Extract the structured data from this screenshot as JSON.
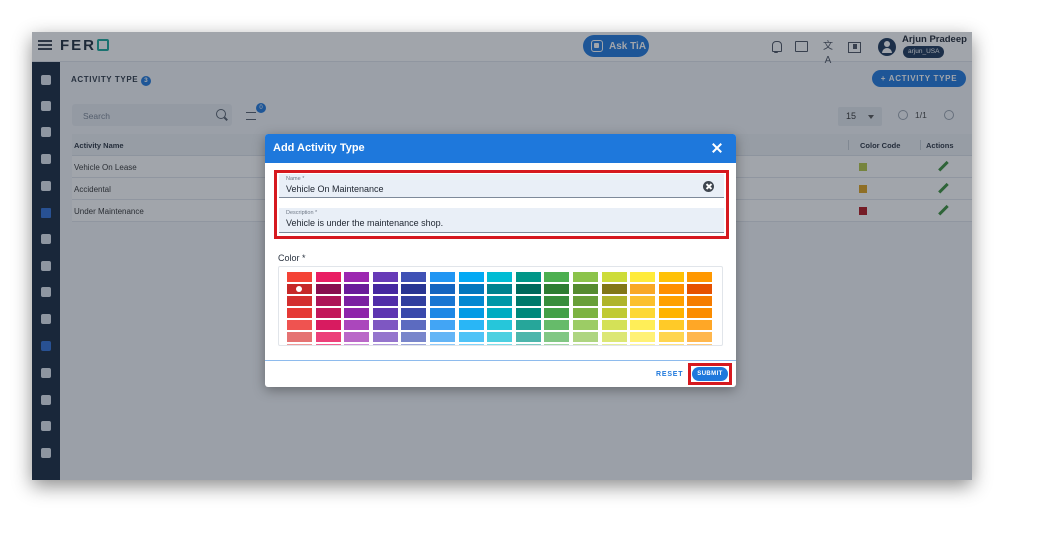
{
  "app": {
    "logo": "FER",
    "ask_button": "Ask TiA",
    "user_name": "Arjun Pradeep",
    "user_role": "arjun_USA",
    "translate_glyph": "文A"
  },
  "page": {
    "title": "ACTIVITY TYPE",
    "count": "3",
    "add_button": "+ ACTIVITY TYPE",
    "search_placeholder": "Search",
    "filter_count": "0",
    "per_page": "15",
    "pagination": "1/1"
  },
  "table": {
    "columns": {
      "name": "Activity Name",
      "color": "Color Code",
      "actions": "Actions"
    },
    "rows": [
      {
        "name": "Vehicle On Lease",
        "color": "#b5c742"
      },
      {
        "name": "Accidental",
        "color": "#e0a21a"
      },
      {
        "name": "Under Maintenance",
        "color": "#b3141b"
      }
    ]
  },
  "modal": {
    "title": "Add Activity Type",
    "name_label": "Name *",
    "name_value": "Vehicle On Maintenance",
    "description_label": "Description *",
    "description_value": "Vehicle is under the maintenance shop.",
    "color_label": "Color *",
    "reset_label": "RESET",
    "submit_label": "SUBMIT",
    "selected_color": "#c62828"
  },
  "palette": {
    "rows": [
      [
        "#f44336",
        "#e91e63",
        "#9c27b0",
        "#673ab7",
        "#3f51b5",
        "#2196f3",
        "#03a9f4",
        "#00bcd4",
        "#009688",
        "#4caf50",
        "#8bc34a",
        "#cddc39",
        "#ffeb3b",
        "#ffc107",
        "#ff9800"
      ],
      [
        "#c62828",
        "#880e4f",
        "#6a1b9a",
        "#4527a0",
        "#283593",
        "#1565c0",
        "#0277bd",
        "#00838f",
        "#00695c",
        "#2e7d32",
        "#558b2f",
        "#827717",
        "#f9a825",
        "#ff8f00",
        "#e65100"
      ],
      [
        "#d32f2f",
        "#ad1457",
        "#7b1fa2",
        "#512da8",
        "#303f9f",
        "#1976d2",
        "#0288d1",
        "#0097a7",
        "#00796b",
        "#388e3c",
        "#689f38",
        "#afb42b",
        "#fbc02d",
        "#ffa000",
        "#f57c00"
      ],
      [
        "#e53935",
        "#c2185b",
        "#8e24aa",
        "#5e35b1",
        "#3949ab",
        "#1e88e5",
        "#039be5",
        "#00acc1",
        "#00897b",
        "#43a047",
        "#7cb342",
        "#c0ca33",
        "#fdd835",
        "#ffb300",
        "#fb8c00"
      ],
      [
        "#ef5350",
        "#d81b60",
        "#ab47bc",
        "#7e57c2",
        "#5c6bc0",
        "#42a5f5",
        "#29b6f6",
        "#26c6da",
        "#26a69a",
        "#66bb6a",
        "#9ccc65",
        "#d4e157",
        "#ffee58",
        "#ffca28",
        "#ffa726"
      ],
      [
        "#e57373",
        "#ec407a",
        "#ba68c8",
        "#9575cd",
        "#7986cb",
        "#64b5f6",
        "#4fc3f7",
        "#4dd0e1",
        "#4db6ac",
        "#81c784",
        "#aed581",
        "#dce775",
        "#fff176",
        "#ffd54f",
        "#ffb74d"
      ],
      [
        "#ef9a9a",
        "#f06292",
        "#ce93d8",
        "#b39ddb",
        "#9fa8da",
        "#90caf9",
        "#81d4fa",
        "#80deea",
        "#80cbc4",
        "#a5d6a7",
        "#c5e1a5",
        "#e6ee9c",
        "#fff59d",
        "#ffe082",
        "#ffcc80"
      ]
    ]
  }
}
